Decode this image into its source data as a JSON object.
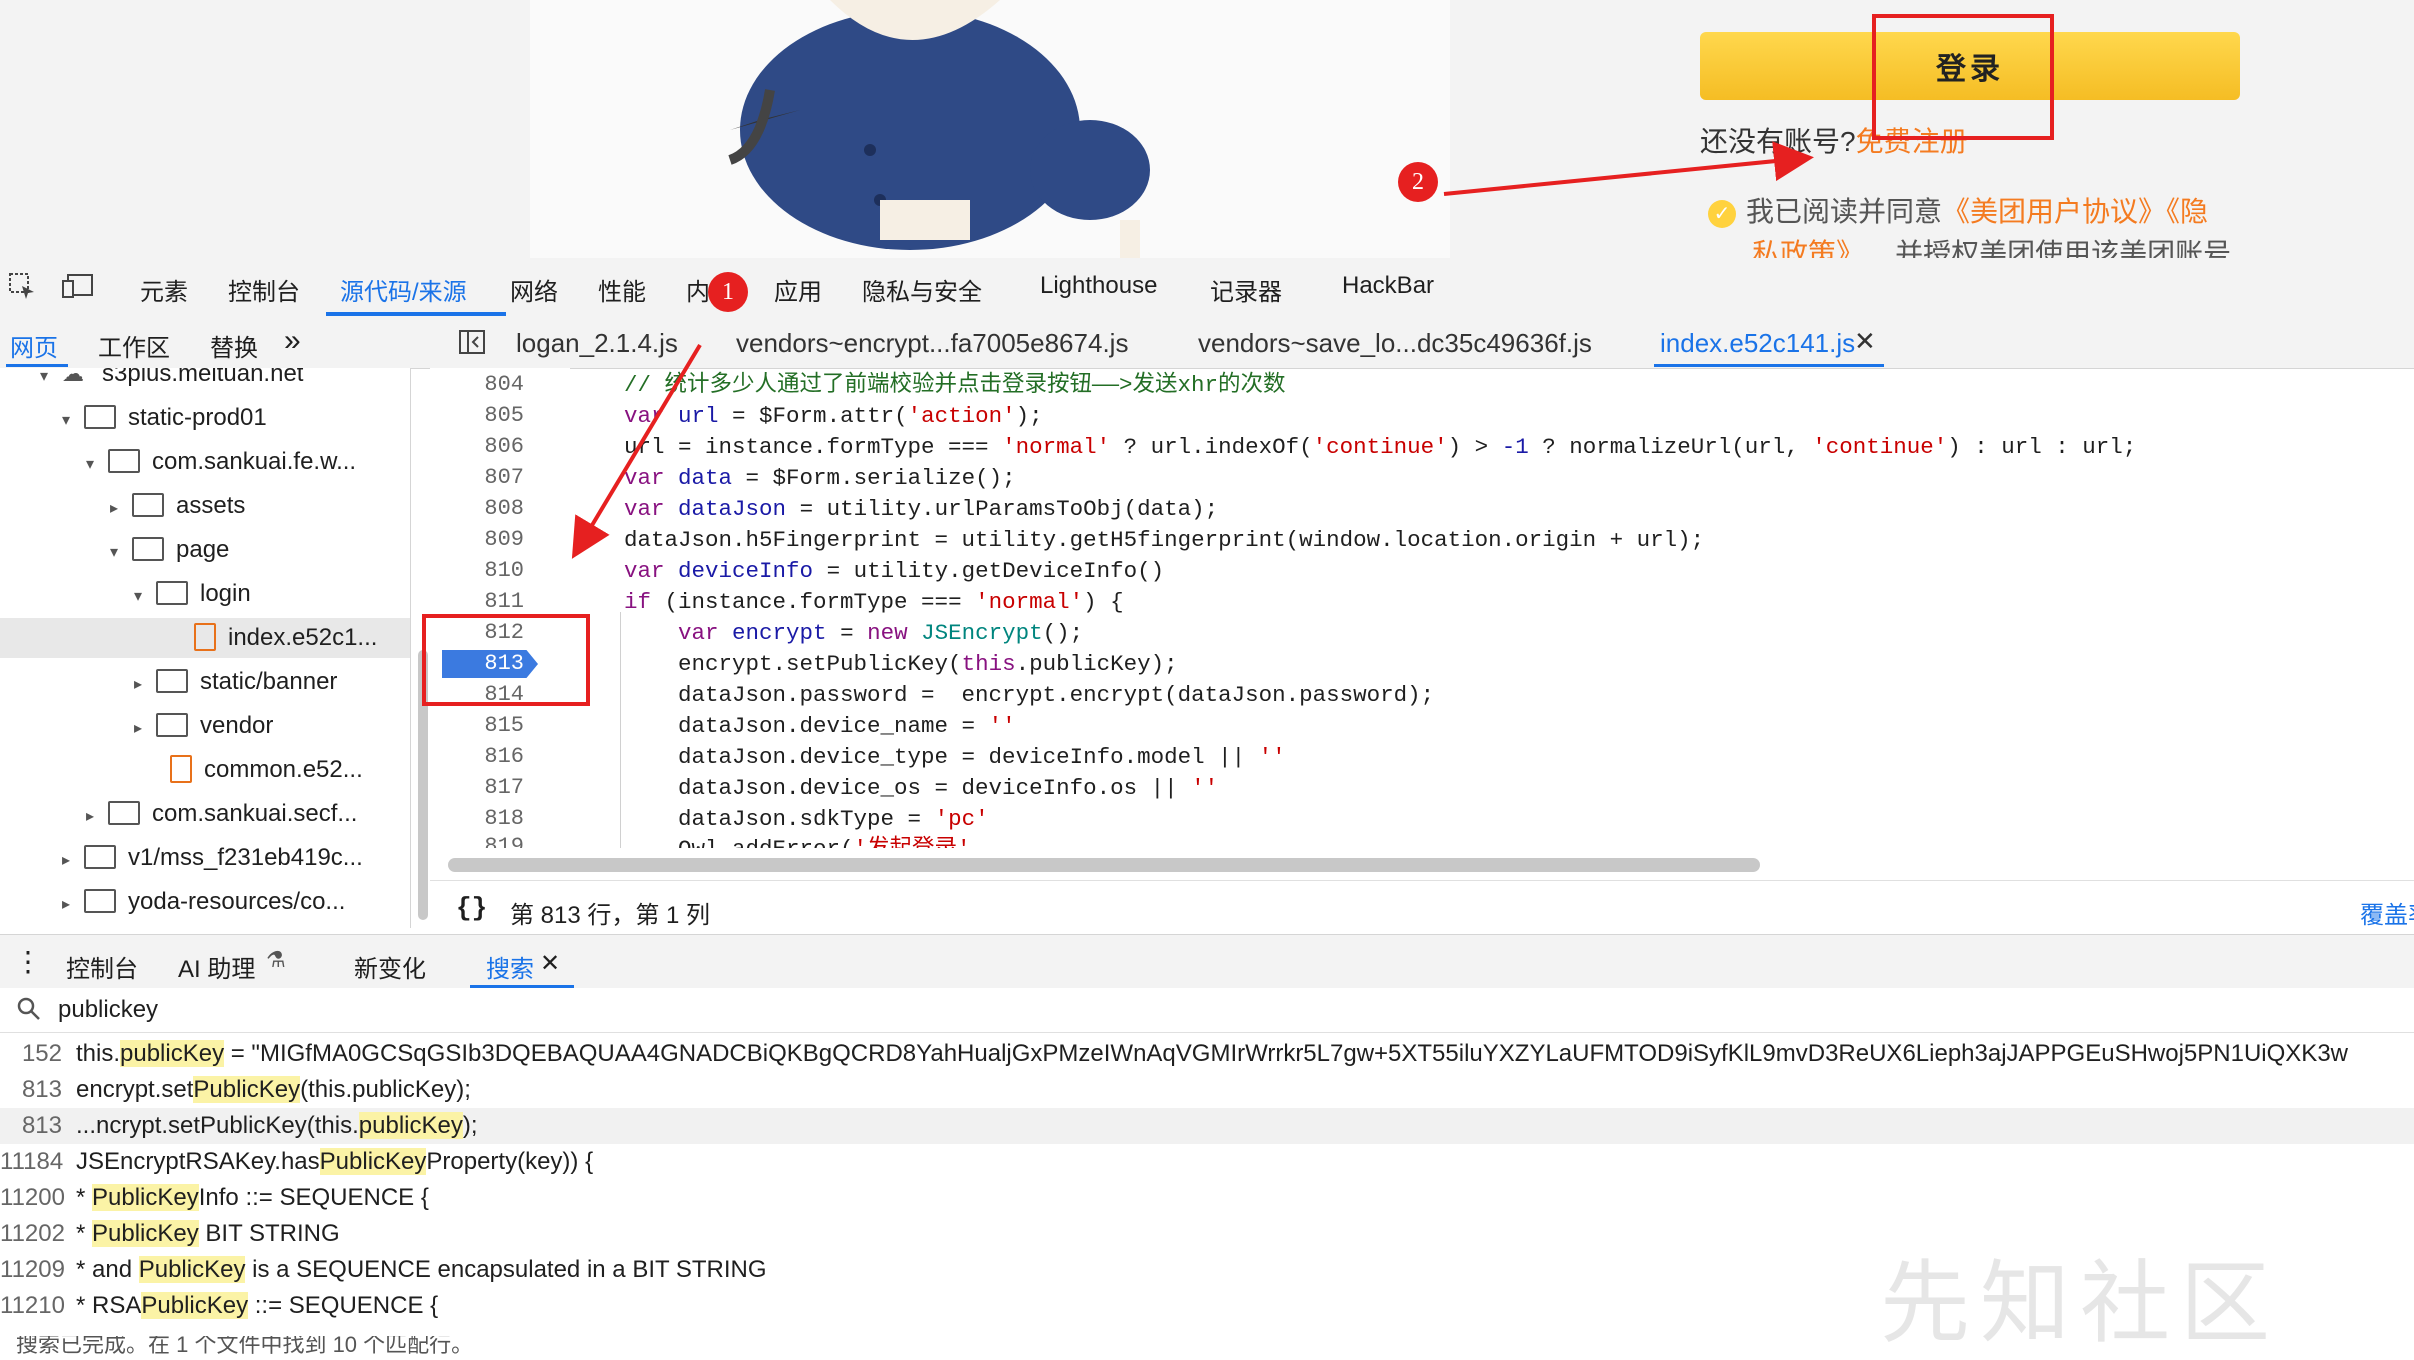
{
  "webpage": {
    "login_button": "登录",
    "no_account": "还没有账号?",
    "register_link": "免费注册",
    "agree_prefix": "我已阅读并同意",
    "agreement_link": "《美团用户协议》《隐",
    "agreement_link2": "私政策》",
    "agree_suffix": "并授权美团使用该美团账号"
  },
  "devtools": {
    "main_tabs": [
      "元素",
      "控制台",
      "源代码/来源",
      "网络",
      "性能",
      "内",
      "应用",
      "隐私与安全",
      "Lighthouse",
      "记录器",
      "HackBar"
    ],
    "active_main_tab": "源代码/来源",
    "left_tabs": [
      "网页",
      "工作区",
      "替换"
    ],
    "left_more": "»",
    "editor_tabs": [
      "logan_2.1.4.js",
      "vendors~encrypt...fa7005e8674.js",
      "vendors~save_lo...dc35c49636f.js",
      "index.e52c141.js"
    ],
    "active_editor_tab": "index.e52c141.js",
    "tree": [
      {
        "label": "s3plus.meituan.net",
        "type": "cloud"
      },
      {
        "label": "static-prod01",
        "type": "folder"
      },
      {
        "label": "com.sankuai.fe.w...",
        "type": "folder"
      },
      {
        "label": "assets",
        "type": "folder"
      },
      {
        "label": "page",
        "type": "folder"
      },
      {
        "label": "login",
        "type": "folder"
      },
      {
        "label": "index.e52c1...",
        "type": "file"
      },
      {
        "label": "static/banner",
        "type": "folder"
      },
      {
        "label": "vendor",
        "type": "folder"
      },
      {
        "label": "common.e52...",
        "type": "file"
      },
      {
        "label": "com.sankuai.secf...",
        "type": "folder"
      },
      {
        "label": "v1/mss_f231eb419c...",
        "type": "folder"
      },
      {
        "label": "yoda-resources/co...",
        "type": "folder"
      }
    ],
    "line_numbers": [
      "804",
      "805",
      "806",
      "807",
      "808",
      "809",
      "810",
      "811",
      "812",
      "813",
      "814",
      "815",
      "816",
      "817",
      "818",
      "819"
    ],
    "breakpoint_line": "813",
    "status": "第 813 行，第 1 列",
    "coverage": "覆盖率",
    "drawer_tabs": [
      "控制台",
      "AI 助理",
      "新变化",
      "搜索"
    ],
    "active_drawer_tab": "搜索",
    "search_query": "publickey",
    "results": [
      {
        "line": "152",
        "text": "this.publicKey = \"MIGfMA0GCSqGSIb3DQEBAQUAA4GNADCBiQKBgQCRD8YahHualjGxPMzeIWnAqVGMIrWrrkr5L7gw+5XT55iluYXZYLaUFMTOD9iSyfKlL9mvD3ReUX6Lieph3ajJAPPGEuSHwoj5PN1UiQXK3w"
      },
      {
        "line": "813",
        "text": "encrypt.setPublicKey(this.publicKey);"
      },
      {
        "line": "813",
        "text": "...ncrypt.setPublicKey(this.publicKey);"
      },
      {
        "line": "11184",
        "text": "JSEncryptRSAKey.hasPublicKeyProperty(key)) {"
      },
      {
        "line": "11200",
        "text": "* PublicKeyInfo ::= SEQUENCE {"
      },
      {
        "line": "11202",
        "text": "* PublicKey BIT STRING"
      },
      {
        "line": "11209",
        "text": "* and PublicKey is a SEQUENCE encapsulated in a BIT STRING"
      },
      {
        "line": "11210",
        "text": "* RSAPublicKey ::= SEQUENCE {"
      }
    ],
    "summary_partial": "搜索已完成。在 1 个文件中找到 10 个匹配行。"
  },
  "annotations": {
    "badge1": "1",
    "badge2": "2"
  },
  "watermark": "先知社区",
  "colors": {
    "accent": "#1a73e8",
    "annotation_red": "#e62020",
    "login_yellow": "#f5bd24",
    "link_orange": "#f47b20",
    "highlight": "#fbf3a6"
  }
}
